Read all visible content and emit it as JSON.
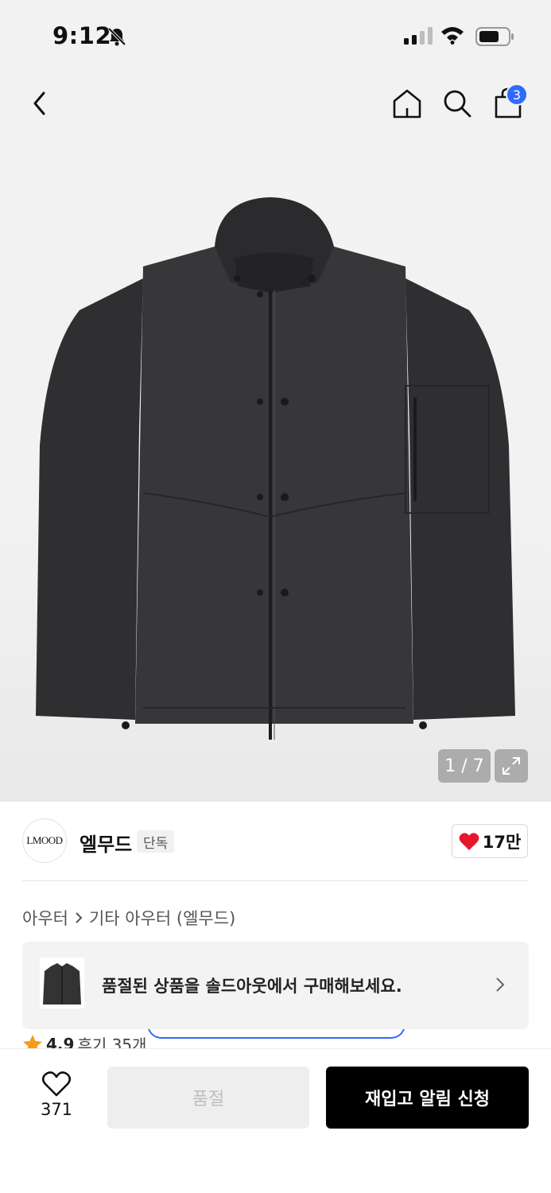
{
  "status_bar": {
    "time": "9:12",
    "icons": [
      "bell-slash-icon",
      "cellular-signal-icon",
      "wifi-icon",
      "battery-icon"
    ]
  },
  "header": {
    "icons": [
      "back-chevron-icon",
      "home-icon",
      "search-icon",
      "shopping-bag-icon"
    ],
    "cart_count": "3"
  },
  "gallery": {
    "counter": "1 / 7",
    "image_subject": "dark charcoal hooded zip-up work jacket"
  },
  "brand": {
    "logo_text": "LMOOD",
    "name": "엘무드",
    "tag": "단독",
    "likes": "17만"
  },
  "breadcrumb": {
    "items": [
      "아우터",
      "기타 아우터 (엘무드)"
    ]
  },
  "soldout_banner": {
    "text": "품절된 상품을 솔드아웃에서 구매해보세요."
  },
  "rating": {
    "score": "4.9",
    "reviews": "후기 35개"
  },
  "bottom_bar": {
    "wish_count": "371",
    "sold_out_label": "품절",
    "restock_label": "재입고 알림 신청"
  },
  "colors": {
    "accent_blue": "#2f6bff",
    "heart_red": "#e5172b",
    "primary_black": "#000000",
    "gallery_bg": "#f2f2f2"
  }
}
